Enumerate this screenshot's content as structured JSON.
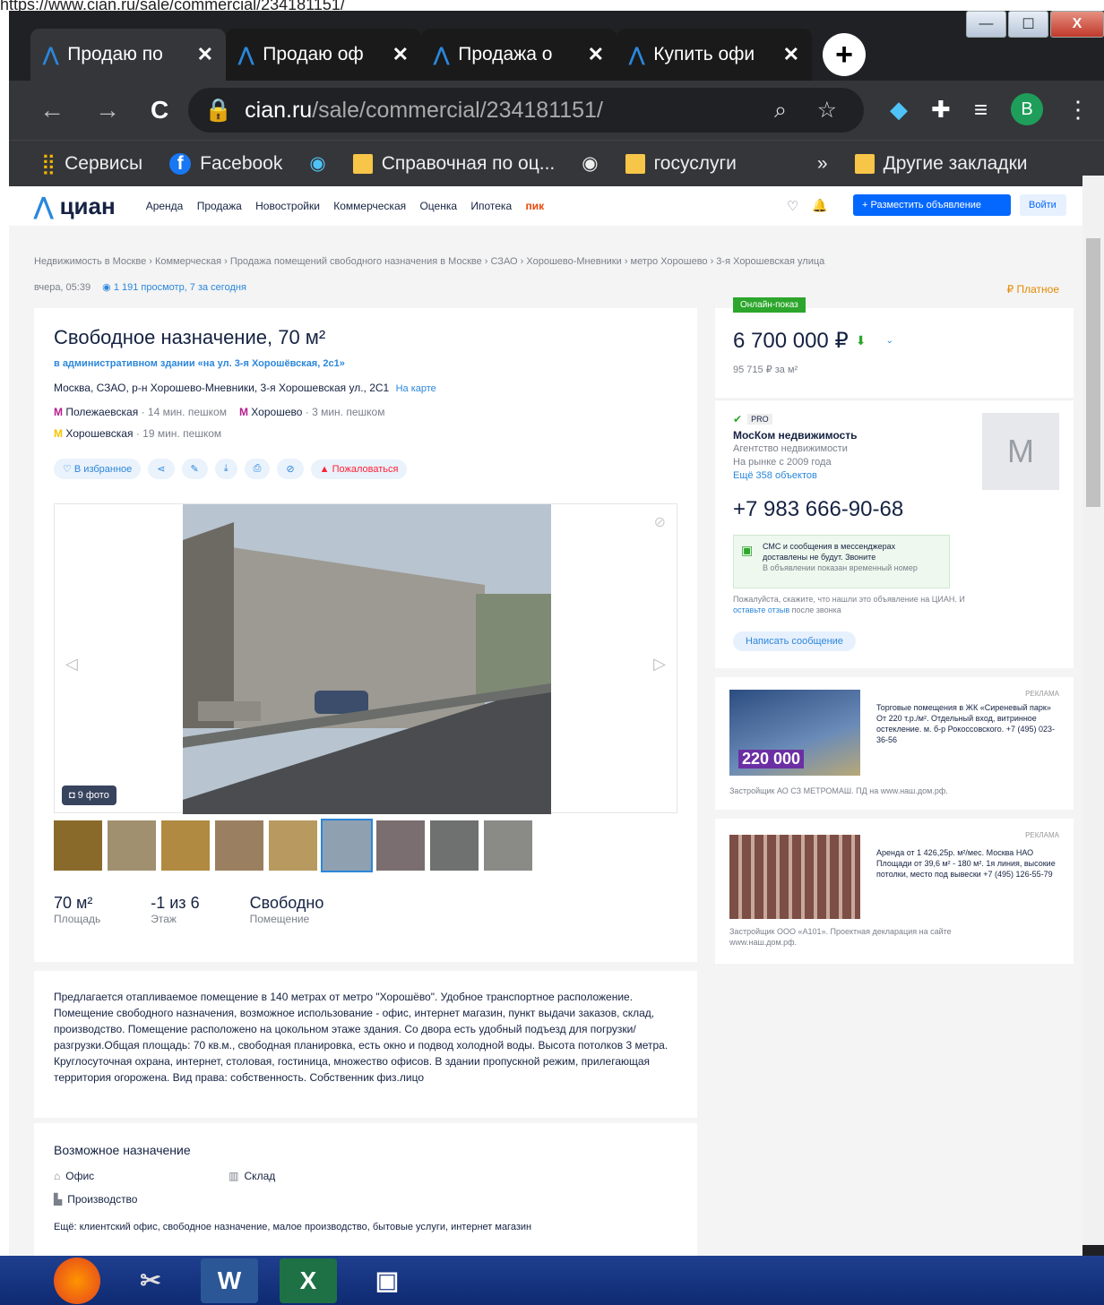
{
  "top_url": "https://www.cian.ru/sale/commercial/234181151/",
  "window": {
    "minimize": "—",
    "maximize": "☐",
    "close": "X"
  },
  "tabs": [
    {
      "title": "Продаю по",
      "close": "✕"
    },
    {
      "title": "Продаю оф",
      "close": "✕"
    },
    {
      "title": "Продажа о",
      "close": "✕"
    },
    {
      "title": "Купить офи",
      "close": "✕"
    }
  ],
  "new_tab": "+",
  "toolbar": {
    "back": "←",
    "forward": "→",
    "reload": "C",
    "host": "cian.ru",
    "path": "/sale/commercial/234181151/",
    "avatar": "B"
  },
  "bookmarks": [
    {
      "label": "Сервисы",
      "icon": "apps-icon"
    },
    {
      "label": "Facebook",
      "icon": "facebook-icon"
    },
    {
      "label": "",
      "icon": "globe-icon"
    },
    {
      "label": "Справочная по оц...",
      "icon": "folder-icon"
    },
    {
      "label": "",
      "icon": "globe-icon"
    },
    {
      "label": "госуслуги",
      "icon": "folder-icon"
    }
  ],
  "bookmarks_more": "»",
  "other_bookmarks": "Другие закладки",
  "site": {
    "logo": "циан",
    "menu": [
      "Аренда",
      "Продажа",
      "Новостройки",
      "Коммерческая",
      "Оценка",
      "Ипотека"
    ],
    "pik": "пик",
    "post_ad": "+ Разместить объявление",
    "login": "Войти"
  },
  "breadcrumbs": "Недвижимость в Москве  ›  Коммерческая  ›  Продажа помещений свободного назначения в Москве  ›  СЗАО  ›  Хорошево-Мневники  ›  метро Хорошево  ›  3-я Хорошевская улица",
  "meta": {
    "date": "вчера, 05:39",
    "views": "1 191 просмотр, 7 за сегодня",
    "paid": "₽ Платное"
  },
  "listing": {
    "title": "Свободное назначение, 70 м²",
    "subtitle": "в административном здании «на ул. 3-я Хорошёвская, 2с1»",
    "address": "Москва, СЗАО, р-н Хорошево-Мневники, 3-я Хорошевская ул., 2С1",
    "map_link": "На карте",
    "metro": [
      {
        "name": "Полежаевская",
        "time": "· 14 мин. пешком",
        "color": "#b61d8e"
      },
      {
        "name": "Хорошево",
        "time": "· 3 мин. пешком",
        "color": "#b61d8e"
      },
      {
        "name": "Хорошевская",
        "time": "· 19 мин. пешком",
        "color": "#ffcd1c"
      }
    ],
    "favorite": "♡ В избранное",
    "complain": "▲ Пожаловаться",
    "photo_count": "◘ 9 фото",
    "facts": [
      {
        "value": "70 м²",
        "label": "Площадь"
      },
      {
        "value": "-1 из 6",
        "label": "Этаж"
      },
      {
        "value": "Свободно",
        "label": "Помещение"
      }
    ],
    "description": "Предлагается отапливаемое помещение в 140 метрах от метро \"Хорошёво\". Удобное транспортное расположение. Помещение свободного назначения, возможное использование - офис, интернет магазин, пункт выдачи заказов, склад, производство. Помещение расположено на цокольном этаже здания. Со двора есть удобный подъезд для погрузки/разгрузки.Общая площадь: 70 кв.м., свободная планировка, есть окно и подвод холодной воды. Высота потолков 3 метра. Круглосуточная охрана, интернет, столовая, гостиница, множество офисов. В здании пропускной режим, прилегающая территория огорожена. Вид права: собственность. Собственник физ.лицо",
    "purpose_title": "Возможное назначение",
    "purposes": [
      "Офис",
      "Склад",
      "Производство"
    ],
    "more": "Ещё: клиентский офис, свободное назначение, малое производство, бытовые услуги, интернет магазин"
  },
  "price": {
    "badge": "Онлайн-показ",
    "value": "6 700 000 ₽",
    "per_m2": "95 715 ₽ за м²"
  },
  "agent": {
    "pro": "PRO",
    "name": "МосКом недвижимость",
    "type": "Агентство недвижимости",
    "since": "На рынке с 2009 года",
    "more": "Ещё 358 объектов",
    "avatar": "M",
    "phone": "+7 983 666-90-68",
    "sms1": "СМС и сообщения в мессенджерах",
    "sms2": "доставлены не будут. Звоните",
    "sms3": "В объявлении показан временный номер",
    "note": "Пожалуйста, скажите, что нашли это объявление на ЦИАН. И",
    "review": "оставьте отзыв",
    "note2": "после звонка",
    "write": "Написать сообщение"
  },
  "ads": [
    {
      "tag": "РЕКЛАМА",
      "text": "Торговые помещения в ЖК «Сиреневый парк» От 220 т.р./м². Отдельный вход, витринное остекление. м. б-р Рокоссовского. +7 (495) 023-36-56",
      "price": "220 000",
      "footer": "Застройщик АО СЗ МЕТРОМАШ. ПД на www.наш.дом.рф."
    },
    {
      "tag": "РЕКЛАМА",
      "text": "Аренда от 1 426,25р. м²/мес. Москва НАО Площади от 39,6 м² - 180 м². 1я линия, высокие потолки, место под вывески +7 (495) 126-55-79",
      "footer": "Застройщик ООО «А101». Проектная декларация на сайте www.наш.дом.рф."
    }
  ]
}
